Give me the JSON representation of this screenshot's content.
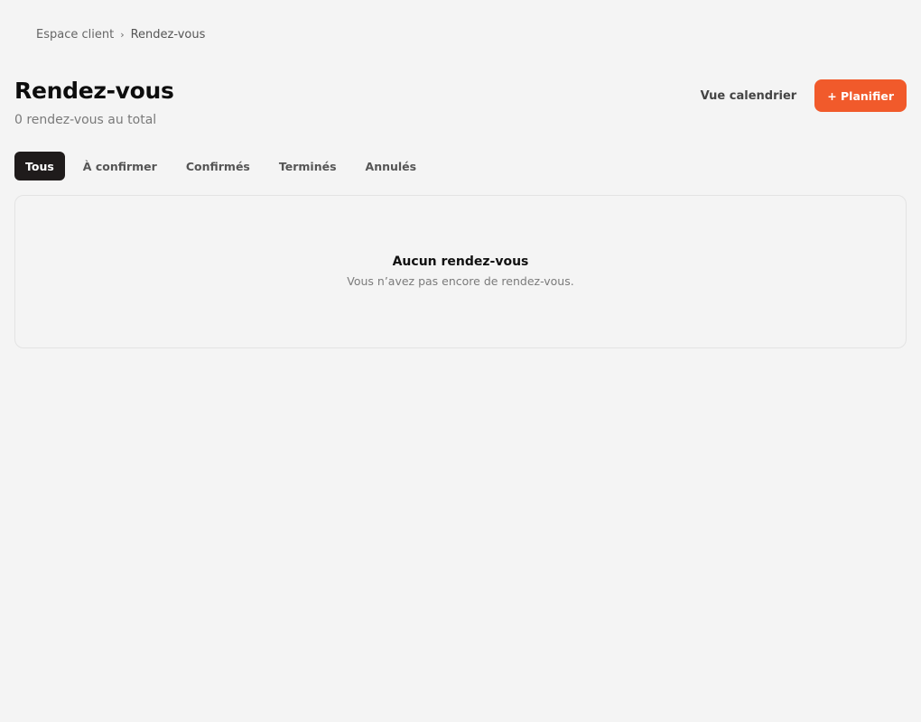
{
  "breadcrumb": {
    "parent": "Espace client",
    "separator": "›",
    "current": "Rendez-vous"
  },
  "header": {
    "title": "Rendez-vous",
    "subtitle": "0 rendez-vous au total",
    "calendar_view_label": "Vue calendrier",
    "schedule_label": "+ Planifier"
  },
  "tabs": [
    {
      "label": "Tous",
      "active": true
    },
    {
      "label": "À confirmer",
      "active": false
    },
    {
      "label": "Confirmés",
      "active": false
    },
    {
      "label": "Terminés",
      "active": false
    },
    {
      "label": "Annulés",
      "active": false
    }
  ],
  "empty_state": {
    "title": "Aucun rendez-vous",
    "description": "Vous n’avez pas encore de rendez-vous."
  },
  "colors": {
    "accent": "#f15a2b",
    "active_tab": "#1f1b1b",
    "background": "#f4f4f4"
  }
}
